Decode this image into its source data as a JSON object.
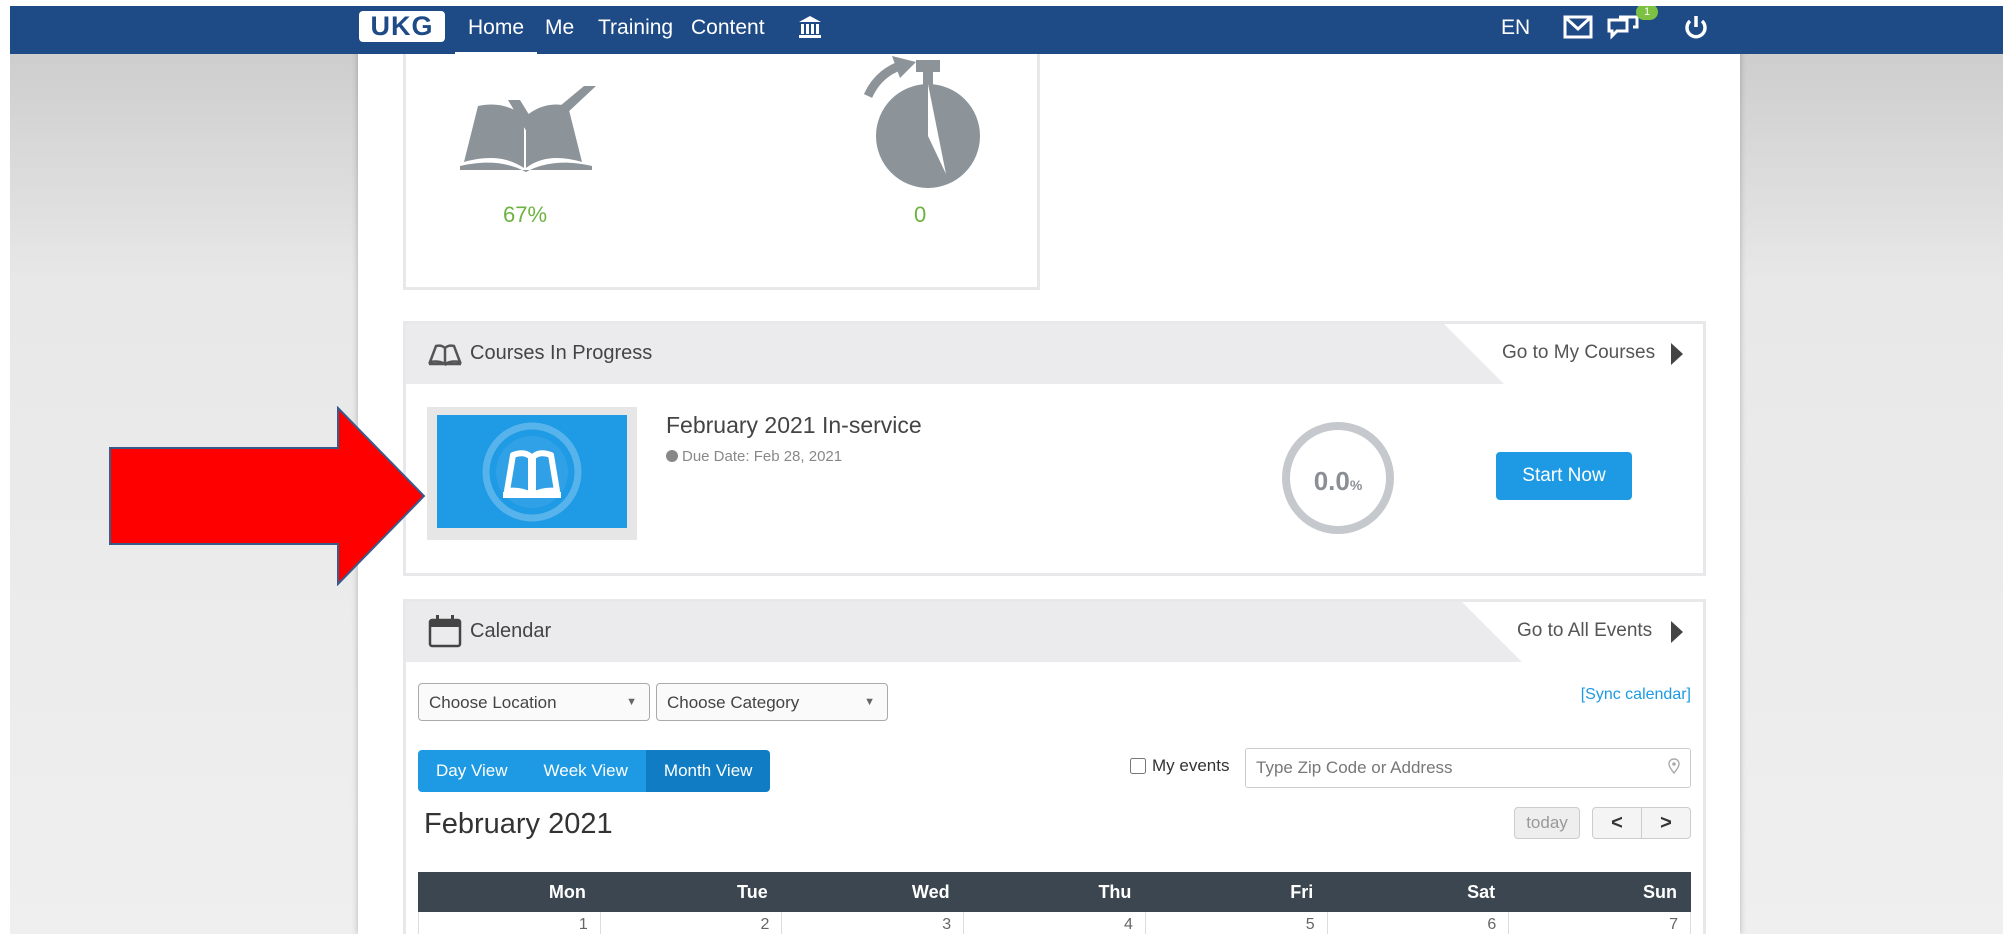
{
  "nav": {
    "logo": "UKG",
    "items": [
      "Home",
      "Me",
      "Training",
      "Content"
    ],
    "language": "EN",
    "chat_badge": "1",
    "icons": [
      "library-icon",
      "mail-icon",
      "chat-icon",
      "power-icon"
    ]
  },
  "stats": {
    "progress_value": "67%",
    "timer_value": "0"
  },
  "courses": {
    "title": "Courses In Progress",
    "goto": "Go to My Courses",
    "item": {
      "title": "February 2021 In-service",
      "due": "Due Date: Feb 28, 2021",
      "progress_number": "0.0",
      "progress_unit": "%",
      "progress_fraction": 0,
      "start_label": "Start Now"
    }
  },
  "calendar": {
    "title": "Calendar",
    "goto": "Go to All Events",
    "location_select": "Choose Location",
    "category_select": "Choose Category",
    "sync": "[Sync calendar]",
    "views": [
      "Day View",
      "Week View",
      "Month View"
    ],
    "active_view": "Month View",
    "my_events": "My events",
    "zip_placeholder": "Type Zip Code or Address",
    "month_title": "February 2021",
    "today": "today",
    "prev": "<",
    "next": ">",
    "weekdays": [
      "Mon",
      "Tue",
      "Wed",
      "Thu",
      "Fri",
      "Sat",
      "Sun"
    ],
    "first_week": [
      "1",
      "2",
      "3",
      "4",
      "5",
      "6",
      "7"
    ]
  },
  "colors": {
    "nav_bg": "#1e4a86",
    "accent": "#1d9ae3",
    "stat_green": "#6db33f",
    "arrow_red": "#ff0000"
  }
}
